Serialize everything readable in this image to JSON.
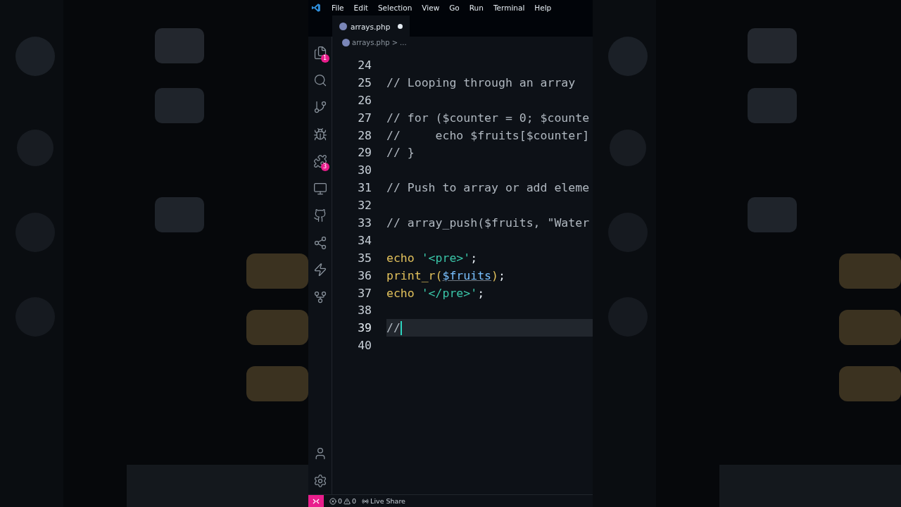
{
  "menu": [
    "File",
    "Edit",
    "Selection",
    "View",
    "Go",
    "Run",
    "Terminal",
    "Help"
  ],
  "activity": [
    {
      "kind": "files",
      "badge": "1"
    },
    {
      "kind": "search"
    },
    {
      "kind": "branch"
    },
    {
      "kind": "bug"
    },
    {
      "kind": "puzzle",
      "badge": "3"
    },
    {
      "kind": "monitor"
    },
    {
      "kind": "github"
    },
    {
      "kind": "share"
    },
    {
      "kind": "zap"
    },
    {
      "kind": "graph"
    }
  ],
  "activity_bottom": [
    {
      "kind": "account"
    },
    {
      "kind": "settings"
    }
  ],
  "tabs": [
    {
      "label": "arrays.php",
      "selected": true,
      "modified": true
    }
  ],
  "breadcrumb": [
    "arrays.php",
    ">",
    "..."
  ],
  "lines": [
    {
      "number": "24"
    },
    {
      "number": "25",
      "tokens": [
        {
          "kind": "comment",
          "text": "// Looping through an array"
        }
      ]
    },
    {
      "number": "26"
    },
    {
      "number": "27",
      "tokens": [
        {
          "kind": "comment",
          "text": "// for ($counter = 0; $counte"
        }
      ]
    },
    {
      "number": "28",
      "tokens": [
        {
          "kind": "comment",
          "text": "//     echo $fruits[$counter]"
        }
      ]
    },
    {
      "number": "29",
      "tokens": [
        {
          "kind": "comment",
          "text": "// }"
        }
      ]
    },
    {
      "number": "30"
    },
    {
      "number": "31",
      "tokens": [
        {
          "kind": "comment",
          "text": "// Push to array or add eleme"
        }
      ]
    },
    {
      "number": "32"
    },
    {
      "number": "33",
      "tokens": [
        {
          "kind": "comment",
          "text": "// array_push($fruits, \"Water"
        }
      ]
    },
    {
      "number": "34"
    },
    {
      "number": "35",
      "tokens": [
        {
          "kind": "function",
          "text": "echo"
        },
        {
          "kind": "string",
          "text": "'<pre>'",
          "space_before": true
        },
        {
          "kind": "plain",
          "text": ";"
        }
      ]
    },
    {
      "number": "36",
      "tokens": [
        {
          "kind": "function",
          "text": "print_r("
        },
        {
          "kind": "variable",
          "text": "$fruits"
        },
        {
          "kind": "function",
          "text": ")"
        },
        {
          "kind": "plain",
          "text": ";"
        }
      ]
    },
    {
      "number": "37",
      "tokens": [
        {
          "kind": "function",
          "text": "echo"
        },
        {
          "kind": "string",
          "text": "'</pre>'",
          "space_before": true
        },
        {
          "kind": "plain",
          "text": ";"
        }
      ]
    },
    {
      "number": "38"
    },
    {
      "number": "39",
      "current": true,
      "tokens": [
        {
          "kind": "comment",
          "text": "//"
        }
      ]
    },
    {
      "number": "40"
    }
  ],
  "status": {
    "errors": "0",
    "warnings": "0",
    "live_share": "Live Share"
  }
}
